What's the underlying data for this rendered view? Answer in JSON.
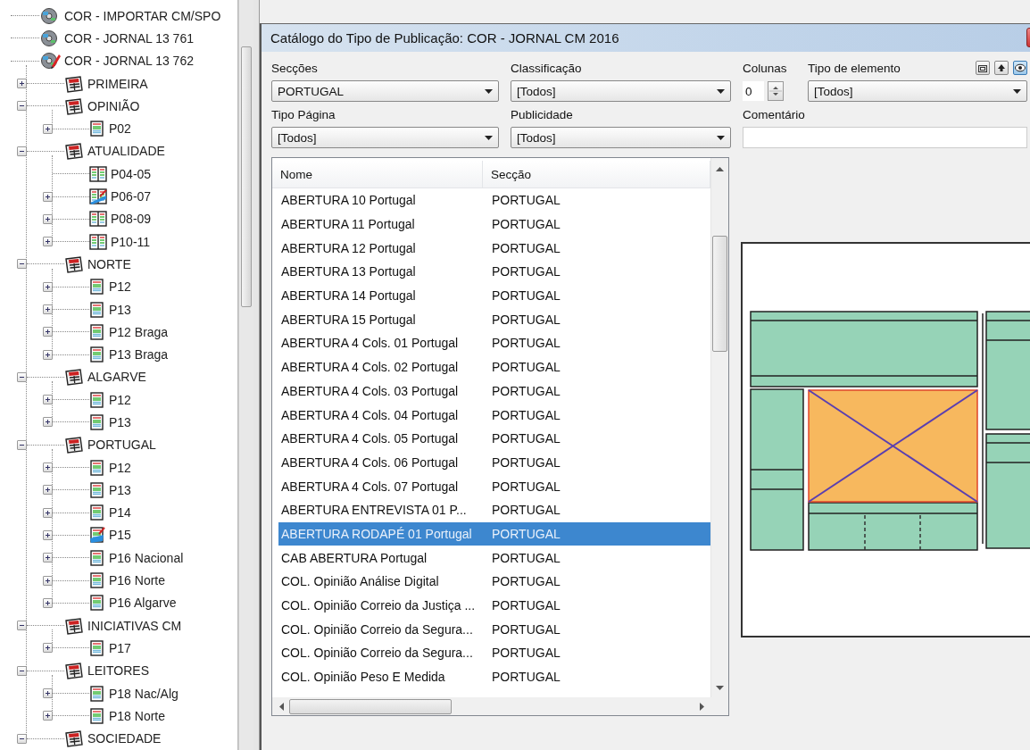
{
  "tree": [
    {
      "label": "COR - IMPORTAR CM/SPO",
      "kind": "publication"
    },
    {
      "label": "COR - JORNAL 13 761",
      "kind": "publication"
    },
    {
      "label": "COR - JORNAL 13 762",
      "kind": "publication-edit",
      "children": [
        {
          "label": "PRIMEIRA",
          "kind": "section",
          "expanded": false
        },
        {
          "label": "OPINIÃO",
          "kind": "section",
          "expanded": true,
          "children": [
            {
              "label": "P02",
              "kind": "page",
              "expandable": true
            }
          ]
        },
        {
          "label": "ATUALIDADE",
          "kind": "section",
          "expanded": true,
          "children": [
            {
              "label": "P04-05",
              "kind": "spread",
              "expandable": false
            },
            {
              "label": "P06-07",
              "kind": "spread-edit",
              "expandable": true
            },
            {
              "label": "P08-09",
              "kind": "spread",
              "expandable": true
            },
            {
              "label": "P10-11",
              "kind": "spread",
              "expandable": true
            }
          ]
        },
        {
          "label": "NORTE",
          "kind": "section",
          "expanded": true,
          "children": [
            {
              "label": "P12",
              "kind": "page",
              "expandable": true
            },
            {
              "label": "P13",
              "kind": "page",
              "expandable": true
            },
            {
              "label": "P12 Braga",
              "kind": "page",
              "expandable": true
            },
            {
              "label": "P13 Braga",
              "kind": "page",
              "expandable": true
            }
          ]
        },
        {
          "label": "ALGARVE",
          "kind": "section",
          "expanded": true,
          "children": [
            {
              "label": "P12",
              "kind": "page",
              "expandable": true
            },
            {
              "label": "P13",
              "kind": "page",
              "expandable": true
            }
          ]
        },
        {
          "label": "PORTUGAL",
          "kind": "section",
          "expanded": true,
          "children": [
            {
              "label": "P12",
              "kind": "page",
              "expandable": true
            },
            {
              "label": "P13",
              "kind": "page",
              "expandable": true
            },
            {
              "label": "P14",
              "kind": "page",
              "expandable": true
            },
            {
              "label": "P15",
              "kind": "page-edit",
              "expandable": true
            },
            {
              "label": "P16 Nacional",
              "kind": "page",
              "expandable": true
            },
            {
              "label": "P16 Norte",
              "kind": "page",
              "expandable": true
            },
            {
              "label": "P16 Algarve",
              "kind": "page",
              "expandable": true
            }
          ]
        },
        {
          "label": "INICIATIVAS CM",
          "kind": "section",
          "expanded": true,
          "children": [
            {
              "label": "P17",
              "kind": "page",
              "expandable": true
            }
          ]
        },
        {
          "label": "LEITORES",
          "kind": "section",
          "expanded": true,
          "children": [
            {
              "label": "P18 Nac/Alg",
              "kind": "page",
              "expandable": true
            },
            {
              "label": "P18 Norte",
              "kind": "page",
              "expandable": true
            }
          ]
        },
        {
          "label": "SOCIEDADE",
          "kind": "section",
          "expanded": true
        }
      ]
    }
  ],
  "dialog": {
    "title": "Catálogo do Tipo de Publicação: COR - JORNAL CM 2016",
    "form_rows": [
      [
        {
          "label": "Secções",
          "kind": "combo",
          "value": "PORTUGAL"
        },
        {
          "label": "Classificação",
          "kind": "combo",
          "value": "[Todos]"
        },
        {
          "label": "Colunas",
          "kind": "spin",
          "value": "0"
        },
        {
          "label": "Tipo de elemento",
          "kind": "combo",
          "value": "[Todos]"
        }
      ],
      [
        {
          "label": "Tipo Página",
          "kind": "combo",
          "value": "[Todos]"
        },
        {
          "label": "Publicidade",
          "kind": "combo",
          "value": "[Todos]"
        },
        {
          "label": "Comentário",
          "kind": "text"
        }
      ]
    ],
    "list": {
      "columns": [
        "Nome",
        "Secção"
      ],
      "rows": [
        {
          "name": "ABERTURA 10 Portugal",
          "section": "PORTUGAL",
          "selected": false
        },
        {
          "name": "ABERTURA 11 Portugal",
          "section": "PORTUGAL",
          "selected": false
        },
        {
          "name": "ABERTURA 12 Portugal",
          "section": "PORTUGAL",
          "selected": false
        },
        {
          "name": "ABERTURA 13 Portugal",
          "section": "PORTUGAL",
          "selected": false
        },
        {
          "name": "ABERTURA 14 Portugal",
          "section": "PORTUGAL",
          "selected": false
        },
        {
          "name": "ABERTURA 15 Portugal",
          "section": "PORTUGAL",
          "selected": false
        },
        {
          "name": "ABERTURA 4 Cols. 01 Portugal",
          "section": "PORTUGAL",
          "selected": false
        },
        {
          "name": "ABERTURA 4 Cols. 02 Portugal",
          "section": "PORTUGAL",
          "selected": false
        },
        {
          "name": "ABERTURA 4 Cols. 03 Portugal",
          "section": "PORTUGAL",
          "selected": false
        },
        {
          "name": "ABERTURA 4 Cols. 04 Portugal",
          "section": "PORTUGAL",
          "selected": false
        },
        {
          "name": "ABERTURA 4 Cols. 05 Portugal",
          "section": "PORTUGAL",
          "selected": false
        },
        {
          "name": "ABERTURA 4 Cols. 06 Portugal",
          "section": "PORTUGAL",
          "selected": false
        },
        {
          "name": "ABERTURA 4 Cols. 07 Portugal",
          "section": "PORTUGAL",
          "selected": false
        },
        {
          "name": "ABERTURA ENTREVISTA 01 P...",
          "section": "PORTUGAL",
          "selected": false
        },
        {
          "name": "ABERTURA RODAPÉ 01 Portugal",
          "section": "PORTUGAL",
          "selected": true
        },
        {
          "name": "CAB ABERTURA Portugal",
          "section": "PORTUGAL",
          "selected": false
        },
        {
          "name": "COL. Opinião Análise Digital",
          "section": "PORTUGAL",
          "selected": false
        },
        {
          "name": "COL. Opinião Correio da Justiça ...",
          "section": "PORTUGAL",
          "selected": false
        },
        {
          "name": "COL. Opinião Correio da Segura...",
          "section": "PORTUGAL",
          "selected": false
        },
        {
          "name": "COL. Opinião Correio da Segura...",
          "section": "PORTUGAL",
          "selected": false
        },
        {
          "name": "COL. Opinião Peso E Medida",
          "section": "PORTUGAL",
          "selected": false
        }
      ]
    }
  }
}
